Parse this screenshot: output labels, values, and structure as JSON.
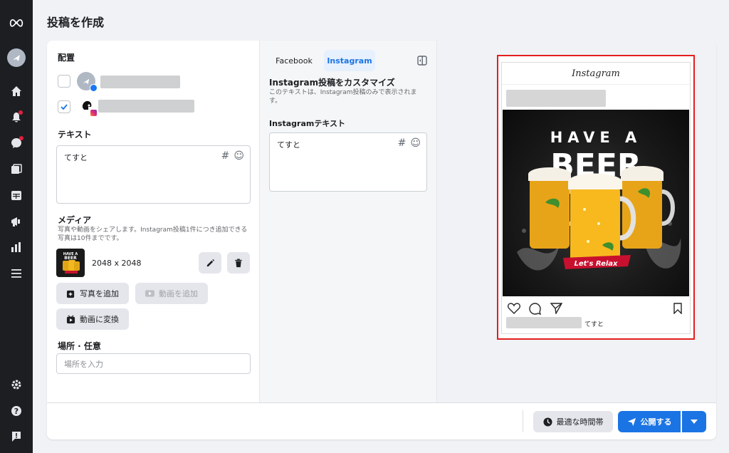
{
  "page": {
    "title": "投稿を作成"
  },
  "nav": {
    "items": [
      "meta-logo",
      "profile-avatar",
      "home-icon",
      "notifications-icon",
      "messages-icon",
      "posts-icon",
      "calendar-icon",
      "ads-icon",
      "insights-icon",
      "menu-icon",
      "settings-icon",
      "help-icon",
      "feedback-icon"
    ]
  },
  "left": {
    "placement_label": "配置",
    "text_label": "テキスト",
    "text_value": "てすと",
    "media_label": "メディア",
    "media_desc": "写真や動画をシェアします。Instagram投稿1件につき追加できる写真は10件までです。",
    "media_item": {
      "dimensions": "2048 x 2048"
    },
    "add_photo": "写真を追加",
    "add_video": "動画を追加",
    "convert_video": "動画に変換",
    "location_label": "場所 · 任意",
    "location_placeholder": "場所を入力"
  },
  "mid": {
    "tabs": [
      "Facebook",
      "Instagram"
    ],
    "active_tab": "Instagram",
    "title": "Instagram投稿をカスタマイズ",
    "desc": "このテキストは、Instagram投稿のみで表示されます。",
    "text_label": "Instagramテキスト",
    "text_value": "てすと"
  },
  "preview": {
    "app_name": "Instagram",
    "image_text_line1": "HAVE A",
    "image_text_line2": "BEER",
    "ribbon_text": "Let's Relax",
    "caption": "てすと"
  },
  "footer": {
    "schedule_label": "最適な時間帯",
    "publish_label": "公開する"
  },
  "colors": {
    "accent": "#1b74e4",
    "highlight": "#e41e1e",
    "nav_bg": "#1c1e21"
  }
}
